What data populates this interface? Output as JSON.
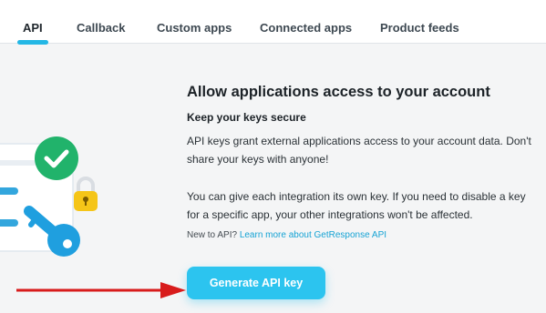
{
  "tabs": [
    {
      "label": "API",
      "active": true
    },
    {
      "label": "Callback",
      "active": false
    },
    {
      "label": "Custom apps",
      "active": false
    },
    {
      "label": "Connected apps",
      "active": false
    },
    {
      "label": "Product feeds",
      "active": false
    }
  ],
  "content": {
    "heading": "Allow applications access to your account",
    "subheading": "Keep your keys secure",
    "paragraph1": "API keys grant external applications access to your account data. Don't share your keys with anyone!",
    "paragraph2": "You can give each integration its own key. If you need to disable a key for a specific app, your other integrations won't be affected.",
    "new_to_api_prefix": "New to API?",
    "learn_more_link": "Learn more about GetResponse API",
    "generate_button": "Generate API key"
  },
  "colors": {
    "accent": "#23b7e5",
    "button": "#2cc4ef",
    "check_green": "#21b36b",
    "lock_yellow": "#f5c518",
    "arrow_red": "#d81c1c"
  },
  "icons": [
    "check-icon",
    "lock-icon",
    "key-icon",
    "arrow-icon"
  ]
}
